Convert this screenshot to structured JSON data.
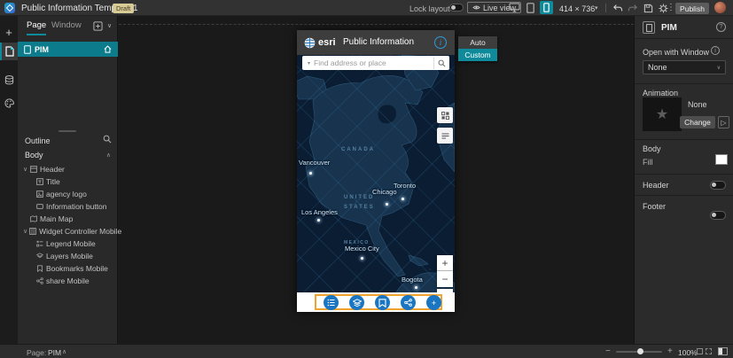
{
  "colors": {
    "accent": "#0e8a9b",
    "esri_blue": "#1a76c2",
    "selection_orange": "#f0a32e",
    "draft_bg": "#d8cc96",
    "map_bg": "#0b1d33"
  },
  "icons": {
    "caret_down": "▾",
    "chevron_down": "∨",
    "chevron_up": "∧",
    "kebab": "⋮",
    "plus": "+",
    "minus": "−",
    "star": "★",
    "play": "▷",
    "question": "?",
    "info": "i"
  },
  "topbar": {
    "title": "Public Information Template 1",
    "draft_badge": "Draft",
    "lock_layout_label": "Lock layout",
    "live_view_label": "Live view",
    "dimensions": "414 × 736",
    "publish_label": "Publish"
  },
  "pages_panel": {
    "tabs": [
      {
        "label": "Page"
      },
      {
        "label": "Window"
      }
    ],
    "page_item": {
      "label": "PIM"
    }
  },
  "outline": {
    "title": "Outline",
    "body_label": "Body",
    "items": [
      {
        "label": "Header"
      },
      {
        "label": "Title"
      },
      {
        "label": "agency logo"
      },
      {
        "label": "Information button"
      },
      {
        "label": "Main Map"
      },
      {
        "label": "Widget Controller Mobile"
      },
      {
        "label": "Legend Mobile"
      },
      {
        "label": "Layers Mobile"
      },
      {
        "label": "Bookmarks Mobile"
      },
      {
        "label": "share Mobile"
      }
    ]
  },
  "canvas": {
    "size_popup": {
      "options": [
        {
          "label": "Auto"
        },
        {
          "label": "Custom"
        }
      ]
    },
    "phone": {
      "brand": "esri",
      "title": "Public Information",
      "search_placeholder": "Find address or place",
      "map": {
        "regions": [
          {
            "text": "CANADA"
          },
          {
            "text": "UNITED STATES"
          },
          {
            "text": "MEXICO"
          }
        ],
        "cities": [
          {
            "text": "Vancouver"
          },
          {
            "text": "Toronto"
          },
          {
            "text": "Chicago"
          },
          {
            "text": "Los Angeles"
          },
          {
            "text": "Mexico City"
          },
          {
            "text": "Bogota"
          }
        ]
      }
    }
  },
  "right_panel": {
    "title": "PIM",
    "open_with_window_label": "Open with Window",
    "open_with_window_value": "None",
    "animation_label": "Animation",
    "animation_value": "None",
    "change_label": "Change",
    "body_label": "Body",
    "fill_label": "Fill",
    "header_label": "Header",
    "footer_label": "Footer"
  },
  "status_bar": {
    "page_label": "Page:",
    "page_value": "PIM",
    "zoom_value": "100%"
  }
}
